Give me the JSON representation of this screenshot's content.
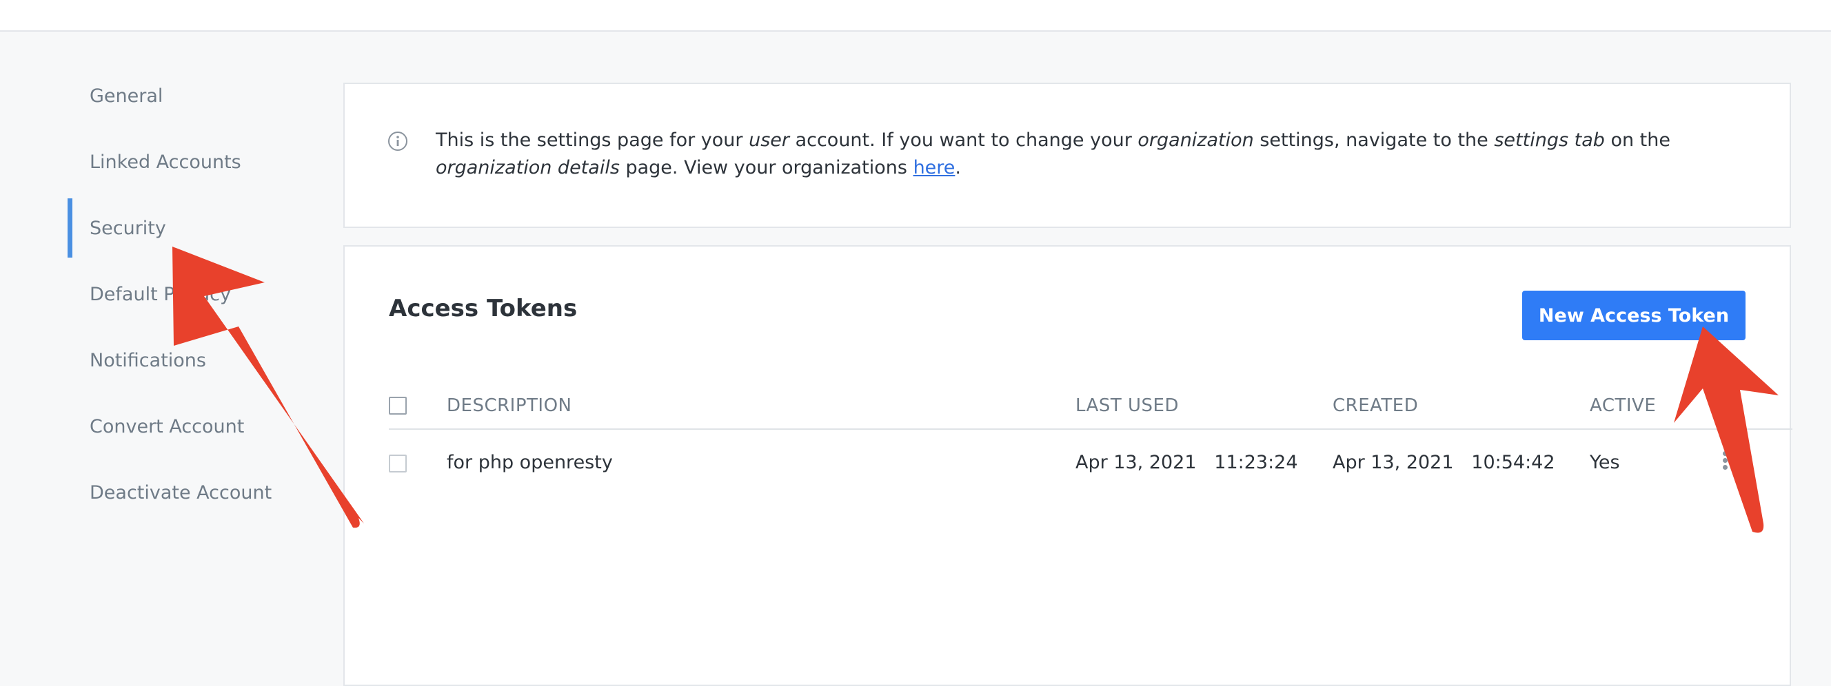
{
  "sidebar": {
    "items": [
      {
        "label": "General"
      },
      {
        "label": "Linked Accounts"
      },
      {
        "label": "Security",
        "active": true
      },
      {
        "label": "Default Privacy"
      },
      {
        "label": "Notifications"
      },
      {
        "label": "Convert Account"
      },
      {
        "label": "Deactivate Account"
      }
    ]
  },
  "info": {
    "icon": "info-icon",
    "text_1": "This is the settings page for your ",
    "em_user": "user",
    "text_2": " account. If you want to change your ",
    "em_organization": "organization",
    "text_3": " settings, navigate to the ",
    "em_settings_tab": "settings tab",
    "text_4": " on the ",
    "em_org_details": "organization details",
    "text_5": " page. View your organizations ",
    "link_here": "here",
    "text_6": "."
  },
  "tokens": {
    "title": "Access Tokens",
    "new_button": "New Access Token",
    "columns": {
      "description": "DESCRIPTION",
      "last_used": "LAST USED",
      "created": "CREATED",
      "active": "ACTIVE"
    },
    "rows": [
      {
        "description": "for php openresty",
        "last_used": "Apr 13, 2021   11:23:24",
        "created": "Apr 13, 2021   10:54:42",
        "active": "Yes"
      }
    ]
  },
  "colors": {
    "accent": "#2f7cf6",
    "active_indicator": "#4a90e2",
    "annotation_arrow": "#e8412c",
    "link": "#2f6fe0"
  }
}
